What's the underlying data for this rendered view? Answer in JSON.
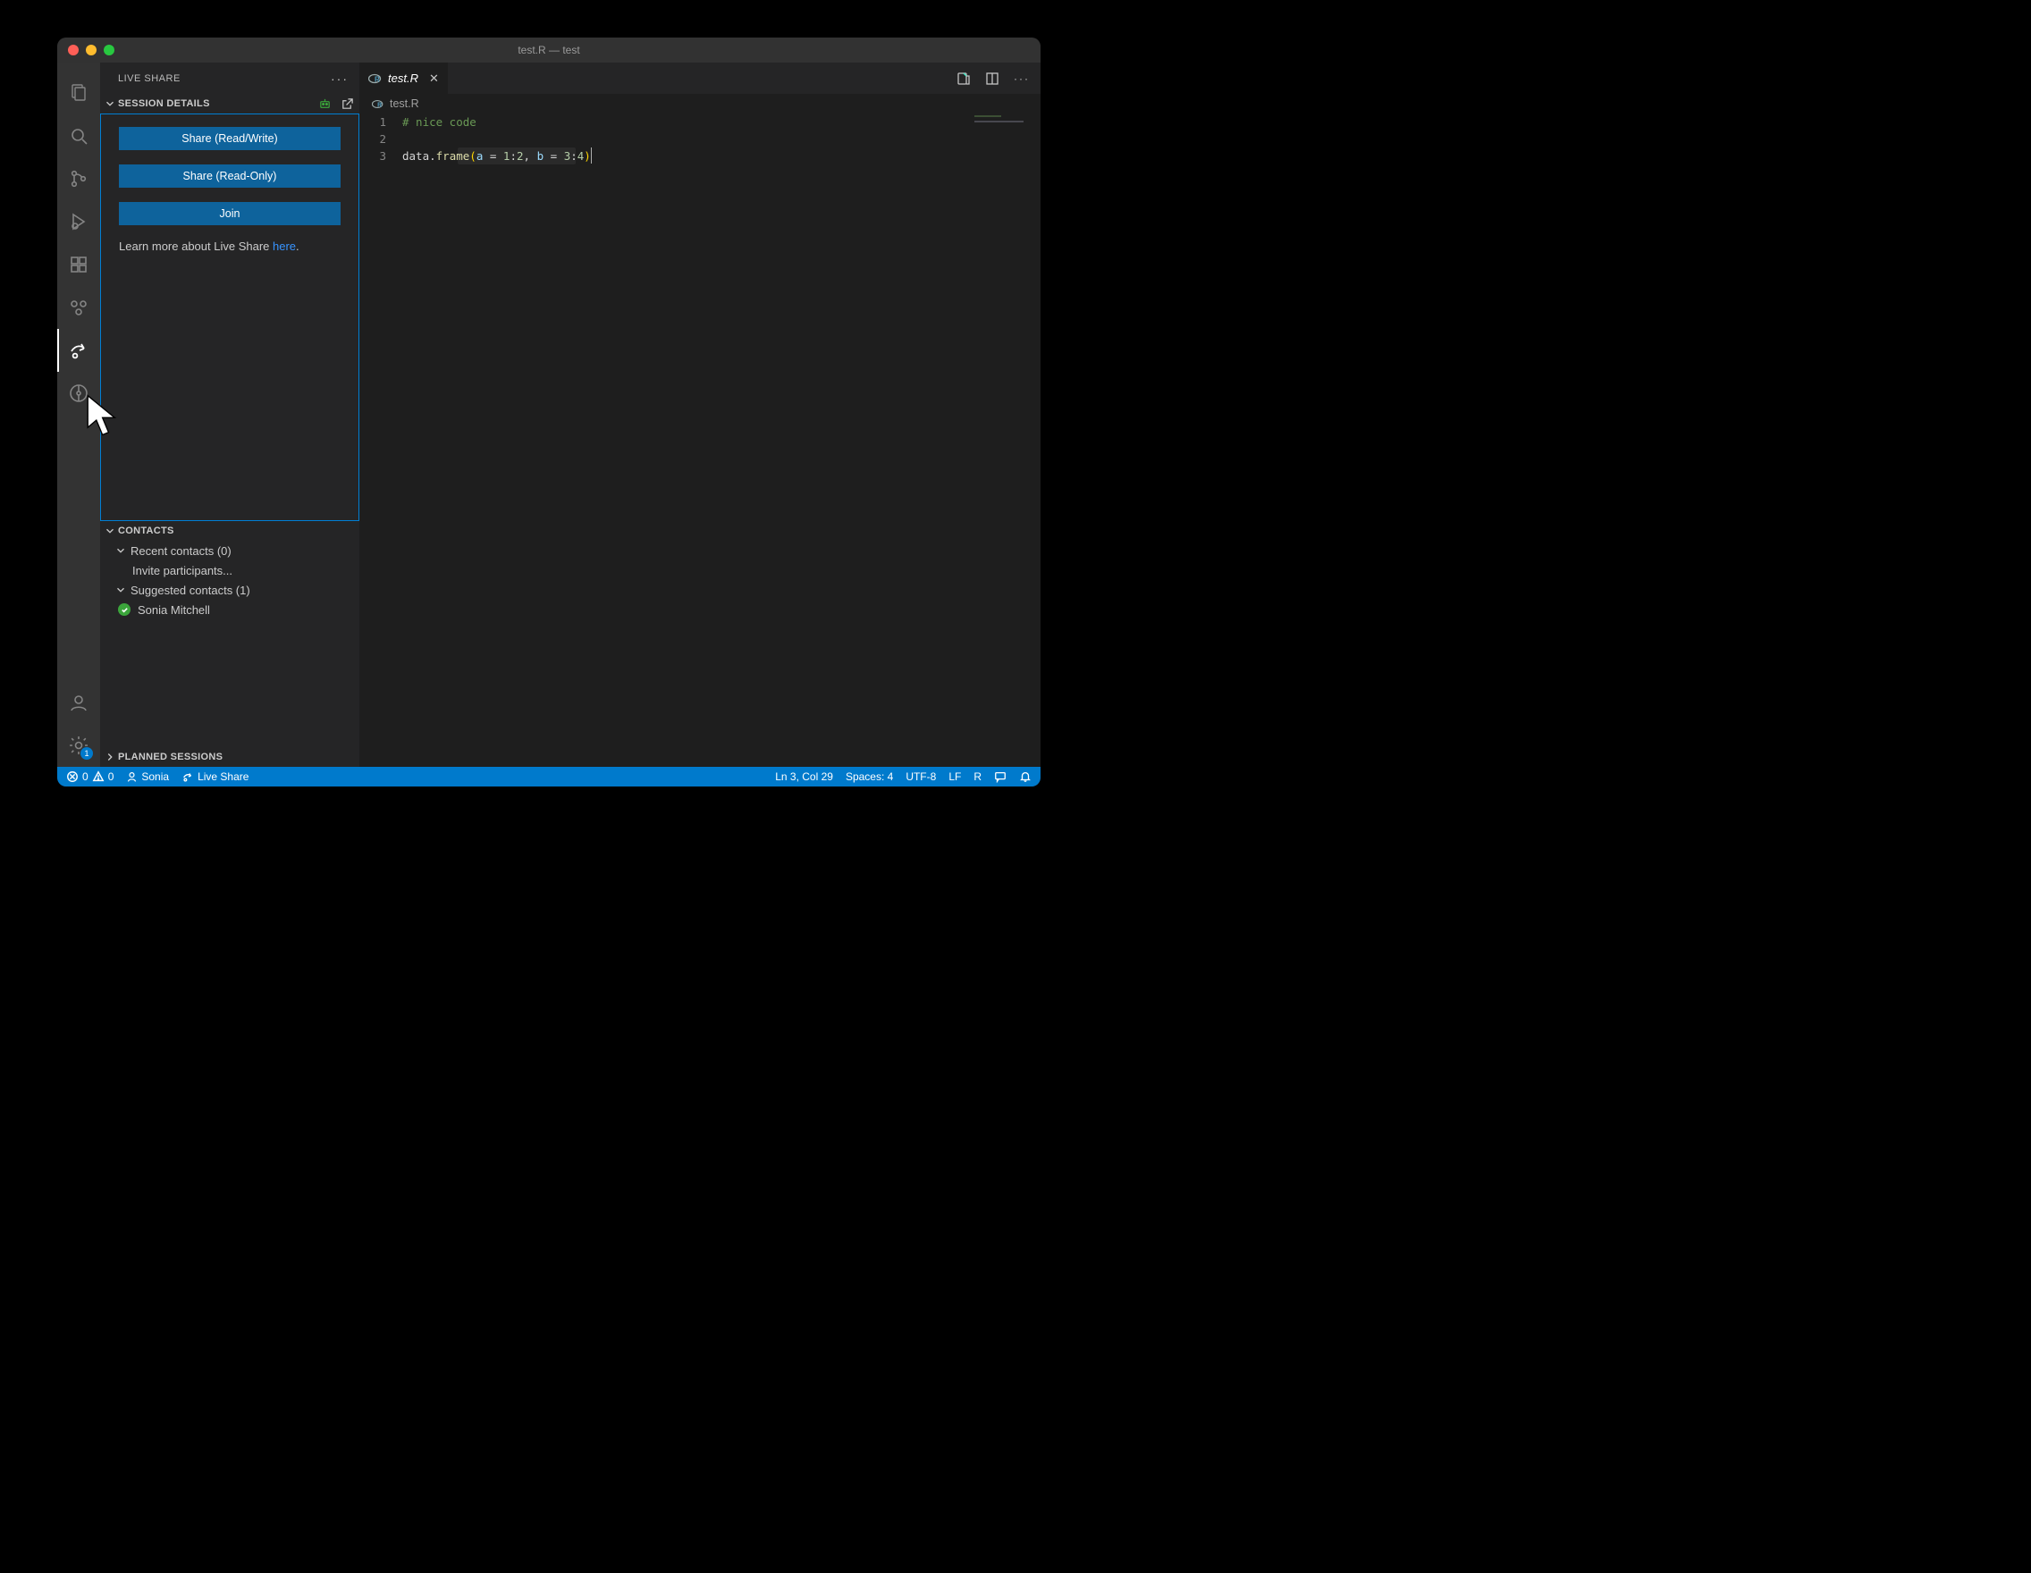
{
  "window": {
    "title": "test.R — test"
  },
  "sidebar": {
    "title": "LIVE SHARE",
    "session": {
      "header": "SESSION DETAILS",
      "share_rw": "Share (Read/Write)",
      "share_ro": "Share (Read-Only)",
      "join": "Join",
      "learn_prefix": "Learn more about Live Share ",
      "learn_link": "here",
      "learn_suffix": "."
    },
    "contacts": {
      "header": "CONTACTS",
      "recent": "Recent contacts (0)",
      "invite": "Invite participants...",
      "suggested": "Suggested contacts (1)",
      "person": "Sonia Mitchell"
    },
    "planned": {
      "header": "PLANNED SESSIONS"
    }
  },
  "activity_badge": "1",
  "tab": {
    "name": "test.R"
  },
  "breadcrumb": {
    "file": "test.R"
  },
  "code": {
    "gutter": [
      "1",
      "2",
      "3"
    ],
    "line1_comment": "# nice code",
    "line3": {
      "ident": "data",
      "dot": ".",
      "call": "frame",
      "lparen": "(",
      "p1": "a",
      "eq": " = ",
      "n1": "1",
      "colon": ":",
      "n2": "2",
      "comma": ", ",
      "p2": "b",
      "n3": "3",
      "n4": "4",
      "rparen": ")"
    }
  },
  "status": {
    "errors": "0",
    "warnings": "0",
    "user": "Sonia",
    "liveshare": "Live Share",
    "lncol": "Ln 3, Col 29",
    "spaces": "Spaces: 4",
    "encoding": "UTF-8",
    "eol": "LF",
    "lang": "R"
  }
}
